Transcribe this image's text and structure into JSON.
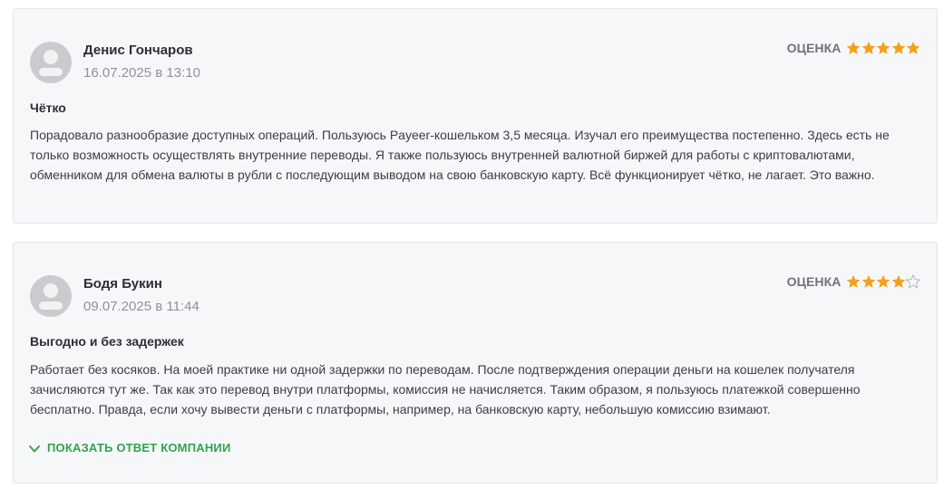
{
  "colors": {
    "star_filled": "#f5a01a",
    "star_empty_outline": "#b5b8bc",
    "accent_green": "#2ea44f",
    "card_background": "#f6f7f9"
  },
  "reviews": [
    {
      "author": "Денис Гончаров",
      "date": "16.07.2025 в 13:10",
      "rating_label": "ОЦЕНКА",
      "rating": 5,
      "rating_max": 5,
      "title": "Чётко",
      "text": "Порадовало разнообразие доступных операций. Пользуюсь Payeer-кошельком 3,5 месяца. Изучал его преимущества постепенно. Здесь есть не только возможность осуществлять внутренние переводы. Я также пользуюсь внутренней валютной биржей для работы с криптовалютами, обменником для обмена валюты в рубли с последующим выводом на свою банковскую карту. Всё функционирует чётко, не лагает. Это важно."
    },
    {
      "author": "Бодя Букин",
      "date": "09.07.2025 в 11:44",
      "rating_label": "ОЦЕНКА",
      "rating": 4,
      "rating_max": 5,
      "title": "Выгодно и без задержек",
      "text": "Работает без косяков. На моей практике ни одной задержки по переводам. После подтверждения операции деньги на кошелек получателя зачисляются тут же. Так как это перевод внутри платформы, комиссия не начисляется. Таким образом, я пользуюсь платежкой совершенно бесплатно. Правда, если хочу вывести деньги с платформы, например, на банковскую карту, небольшую комиссию взимают.",
      "company_reply_toggle": "ПОКАЗАТЬ ОТВЕТ КОМПАНИИ",
      "company_reply_icon": "chevron-down-icon"
    }
  ]
}
